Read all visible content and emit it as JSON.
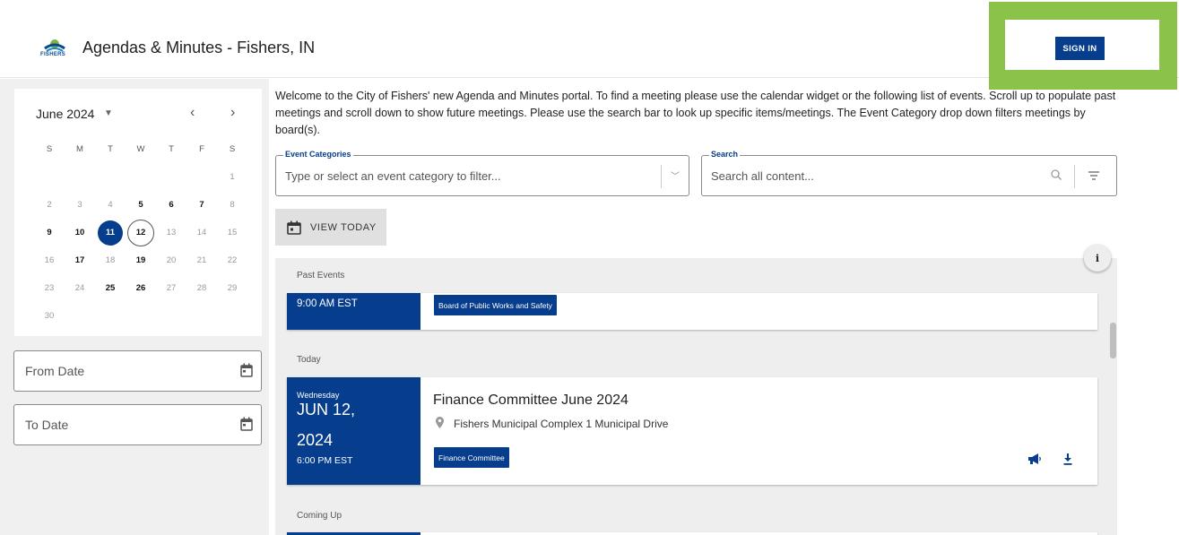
{
  "header": {
    "title": "Agendas & Minutes - Fishers, IN",
    "logo_text": "FISHERS",
    "sign_in_label": "SIGN IN",
    "brand_color": "#063d8c",
    "highlight_color": "#8bc34a"
  },
  "calendar": {
    "month_label": "June 2024",
    "weekdays": [
      "S",
      "M",
      "T",
      "W",
      "T",
      "F",
      "S"
    ],
    "weeks": [
      [
        "",
        "",
        "",
        "",
        "",
        "",
        "1"
      ],
      [
        "2",
        "3",
        "4",
        "5",
        "6",
        "7",
        "8"
      ],
      [
        "9",
        "10",
        "11",
        "12",
        "13",
        "14",
        "15"
      ],
      [
        "16",
        "17",
        "18",
        "19",
        "20",
        "21",
        "22"
      ],
      [
        "23",
        "24",
        "25",
        "26",
        "27",
        "28",
        "29"
      ],
      [
        "30",
        "",
        "",
        "",
        "",
        "",
        ""
      ]
    ],
    "meeting_days": [
      "5",
      "6",
      "7",
      "9",
      "10",
      "17",
      "19",
      "25",
      "26"
    ],
    "today": "11",
    "selected": "12"
  },
  "filters": {
    "from_date_label": "From Date",
    "to_date_label": "To Date"
  },
  "main": {
    "intro": "Welcome to the City of Fishers' new Agenda and Minutes portal. To find a meeting please use the calendar widget or the following list of events. Scroll up to populate past meetings and scroll down to show future meetings. Please use the search bar to look up specific items/meetings. The Event Category drop down filters meetings by board(s).",
    "event_categories_legend": "Event Categories",
    "event_categories_placeholder": "Type or select an event category to filter...",
    "search_legend": "Search",
    "search_placeholder": "Search all content...",
    "view_today_label": "VIEW TODAY",
    "info_label": "i"
  },
  "events": {
    "past_label": "Past Events",
    "today_label": "Today",
    "coming_label": "Coming Up",
    "past_event": {
      "time": "9:00 AM EST",
      "tag": "Board of Public Works and Safety"
    },
    "today_event": {
      "weekday": "Wednesday",
      "date_line1": "JUN 12,",
      "date_line2": "2024",
      "time": "6:00 PM EST",
      "title": "Finance Committee June 2024",
      "location": "Fishers Municipal Complex 1 Municipal Drive",
      "tag": "Finance Committee"
    }
  }
}
